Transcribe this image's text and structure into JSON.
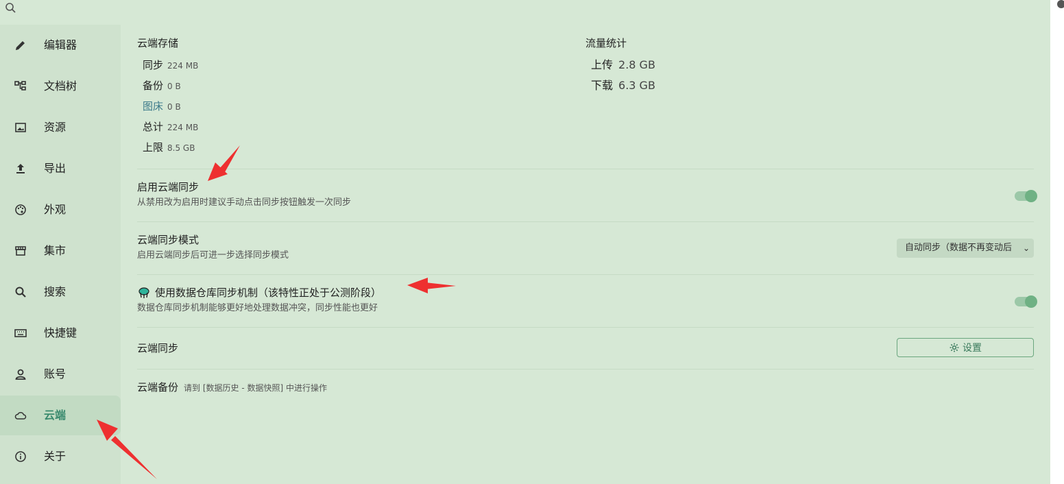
{
  "topbar": {
    "search_icon": "search-icon"
  },
  "sidebar": {
    "items": [
      {
        "label": "编辑器",
        "icon": "pencil-icon"
      },
      {
        "label": "文档树",
        "icon": "tree-icon"
      },
      {
        "label": "资源",
        "icon": "image-icon"
      },
      {
        "label": "导出",
        "icon": "export-icon"
      },
      {
        "label": "外观",
        "icon": "palette-icon"
      },
      {
        "label": "集市",
        "icon": "store-icon"
      },
      {
        "label": "搜索",
        "icon": "search-icon"
      },
      {
        "label": "快捷键",
        "icon": "keyboard-icon"
      },
      {
        "label": "账号",
        "icon": "user-icon"
      },
      {
        "label": "云端",
        "icon": "cloud-icon",
        "active": true
      },
      {
        "label": "关于",
        "icon": "info-icon"
      }
    ]
  },
  "storage": {
    "title": "云端存储",
    "rows": [
      {
        "label": "同步",
        "value": "224 MB"
      },
      {
        "label": "备份",
        "value": "0 B"
      },
      {
        "label": "图床",
        "value": "0 B"
      },
      {
        "label": "总计",
        "value": "224 MB"
      },
      {
        "label": "上限",
        "value": "8.5 GB"
      }
    ]
  },
  "traffic": {
    "title": "流量统计",
    "rows": [
      {
        "label": "上传",
        "value": "2.8 GB"
      },
      {
        "label": "下载",
        "value": "6.3 GB"
      }
    ]
  },
  "settings": {
    "enable_sync": {
      "title": "启用云端同步",
      "desc": "从禁用改为启用时建议手动点击同步按钮触发一次同步",
      "enabled": true
    },
    "sync_mode": {
      "title": "云端同步模式",
      "desc": "启用云端同步后可进一步选择同步模式",
      "selected": "自动同步（数据不再变动后"
    },
    "repo_sync": {
      "title": "使用数据仓库同步机制（该特性正处于公测阶段）",
      "desc": "数据仓库同步机制能够更好地处理数据冲突，同步性能也更好",
      "enabled": true
    },
    "cloud_sync": {
      "title": "云端同步",
      "button": "设置"
    },
    "cloud_backup": {
      "title": "云端备份",
      "note": "请到 [数据历史 - 数据快照] 中进行操作"
    }
  },
  "colors": {
    "accent": "#3a8a6e",
    "toggle_on": "#6fb184",
    "arrow": "#ee3030"
  }
}
